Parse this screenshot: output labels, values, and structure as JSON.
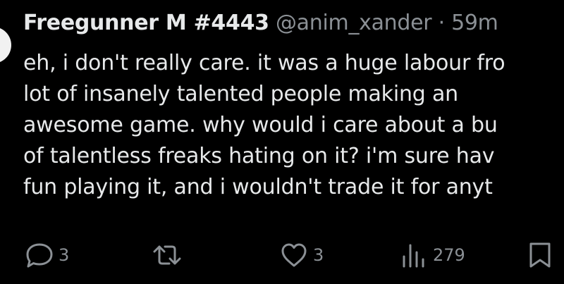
{
  "tweet": {
    "author_name": "Freegunner M #4443",
    "handle": "@anim_xander",
    "separator": "·",
    "timestamp": "59m",
    "lines": [
      "eh, i don't really care. it was a huge labour fro",
      "lot of insanely talented people making an",
      "awesome game. why would i care about a bu",
      "of talentless freaks hating on it? i'm sure hav",
      "fun playing it, and i wouldn't trade it for anyt"
    ]
  },
  "actions": {
    "reply": {
      "icon": "reply-icon",
      "count": "3"
    },
    "repost": {
      "icon": "repost-icon",
      "count": ""
    },
    "like": {
      "icon": "heart-icon",
      "count": "3"
    },
    "views": {
      "icon": "views-icon",
      "count": "279"
    },
    "bookmark": {
      "icon": "bookmark-icon",
      "count": ""
    }
  },
  "colors": {
    "background": "#000000",
    "text_primary": "#e7e9ea",
    "text_secondary": "#8b9095"
  }
}
